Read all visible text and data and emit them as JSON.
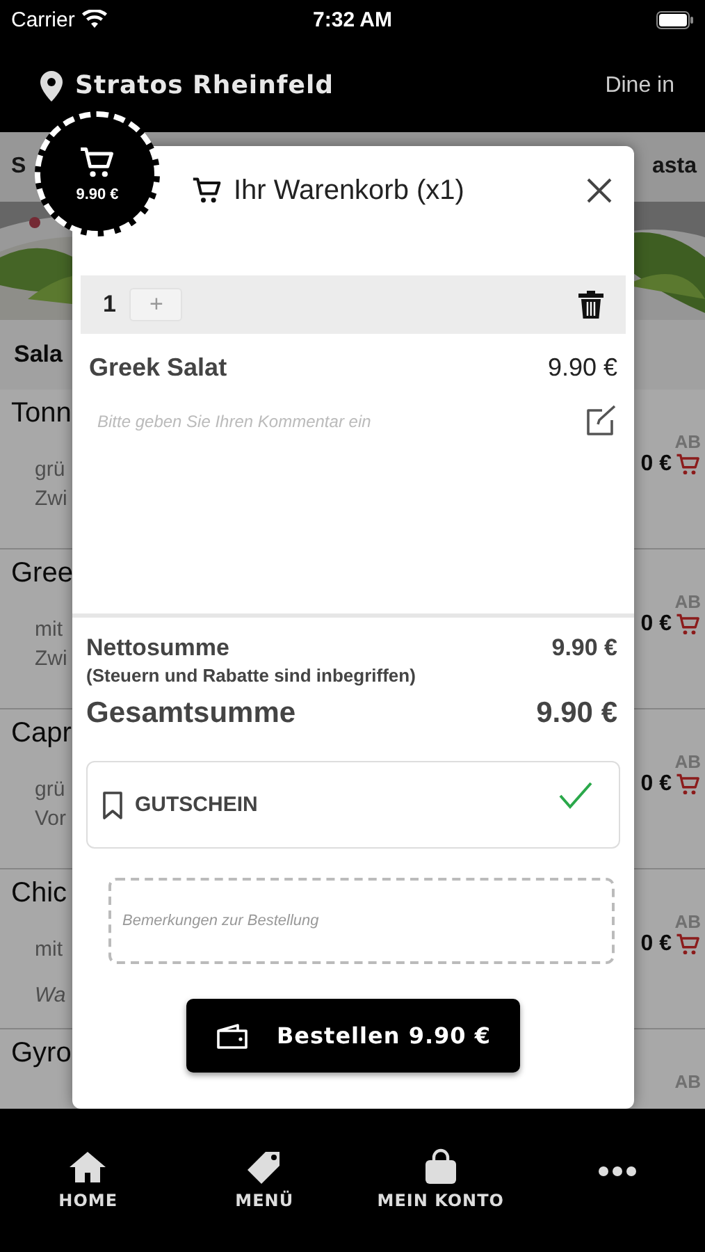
{
  "status_bar": {
    "carrier": "Carrier",
    "time": "7:32 AM"
  },
  "header": {
    "location": "Stratos Rheinfeld",
    "mode": "Dine in"
  },
  "category_tabs": [
    "S",
    "asta"
  ],
  "section_title": "Sala",
  "menu_items": [
    {
      "name": "Tonn",
      "description": [
        "grü",
        "Zwi"
      ],
      "price_prefix": "AB",
      "price": "0 €"
    },
    {
      "name": "Gree",
      "description": [
        "mit",
        "Zwi"
      ],
      "price_prefix": "AB",
      "price": "0 €"
    },
    {
      "name": "Capr",
      "description": [
        "grü",
        "Vor"
      ],
      "price_prefix": "AB",
      "price": "0 €"
    },
    {
      "name": "Chic",
      "description": [
        "mit"
      ],
      "note": "Wa",
      "price_prefix": "AB",
      "price": "0 €"
    },
    {
      "name": "Gyro",
      "price_prefix": "AB"
    }
  ],
  "cart_badge": {
    "total": "9.90 €"
  },
  "cart_dialog": {
    "title": "Ihr Warenkorb (x1)",
    "line_items": [
      {
        "quantity": "1",
        "plus": "+",
        "name": "Greek Salat",
        "price": "9.90 €",
        "comment_placeholder": "Bitte geben Sie Ihren Kommentar ein"
      }
    ],
    "net_label": "Nettosumme",
    "net_value": "9.90 €",
    "tax_note": "(Steuern und Rabatte sind inbegriffen)",
    "total_label": "Gesamtsumme",
    "total_value": "9.90 €",
    "voucher": {
      "label": "GUTSCHEIN",
      "applied": true
    },
    "remarks_placeholder": "Bemerkungen zur Bestellung",
    "order_button": "Bestellen 9.90 €"
  },
  "bottom_nav": [
    {
      "kind": "home",
      "label": "HOME"
    },
    {
      "kind": "tag",
      "label": "MENÜ"
    },
    {
      "kind": "bag",
      "label": "MEIN KONTO"
    },
    {
      "kind": "more"
    }
  ]
}
